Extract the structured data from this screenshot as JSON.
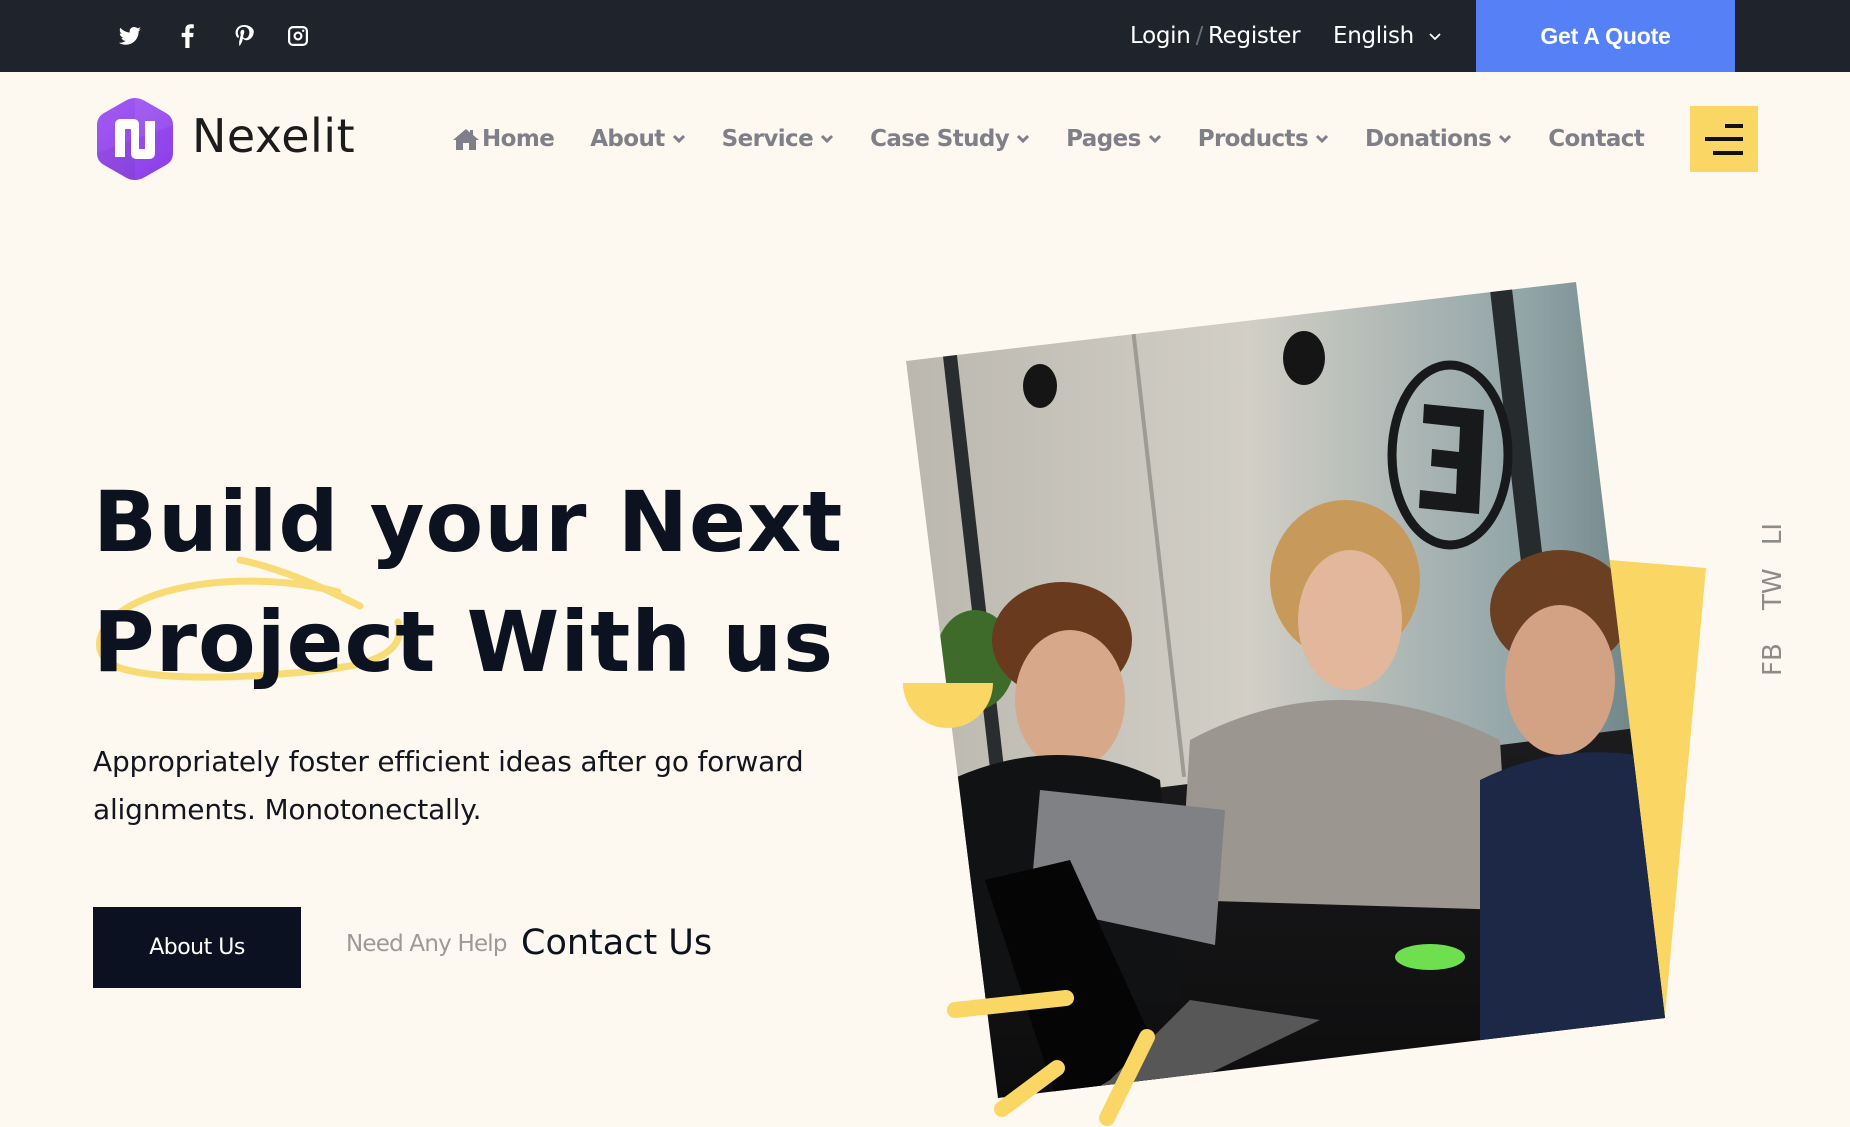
{
  "topbar": {
    "social_icons": [
      "twitter-icon",
      "facebook-icon",
      "pinterest-icon",
      "instagram-icon"
    ],
    "login_label": "Login",
    "separator": "/",
    "register_label": "Register",
    "language": "English",
    "quote_label": "Get A Quote"
  },
  "header": {
    "brand": "Nexelit",
    "nav": [
      {
        "label": "Home",
        "icon": "home-icon",
        "dropdown": false
      },
      {
        "label": "About",
        "dropdown": true
      },
      {
        "label": "Service",
        "dropdown": true
      },
      {
        "label": "Case Study",
        "dropdown": true
      },
      {
        "label": "Pages",
        "dropdown": true
      },
      {
        "label": "Products",
        "dropdown": true
      },
      {
        "label": "Donations",
        "dropdown": true
      },
      {
        "label": "Contact",
        "dropdown": false
      }
    ]
  },
  "hero": {
    "title_line1": "Build your Next",
    "title_line2_highlight": "Project",
    "title_line2_rest": " With us",
    "description": "Appropriately foster efficient ideas after go forward alignments. Monotonectally.",
    "primary_button": "About Us",
    "help_text": "Need Any Help",
    "contact_link": "Contact Us"
  },
  "side_social": [
    "FB",
    "TW",
    "LI"
  ],
  "colors": {
    "topbar_bg": "#1f232b",
    "accent_blue": "#5580f6",
    "accent_yellow": "#fad664",
    "brand_purple": "#9747ee",
    "page_bg": "#fdf9f0",
    "dark": "#0b1120"
  }
}
